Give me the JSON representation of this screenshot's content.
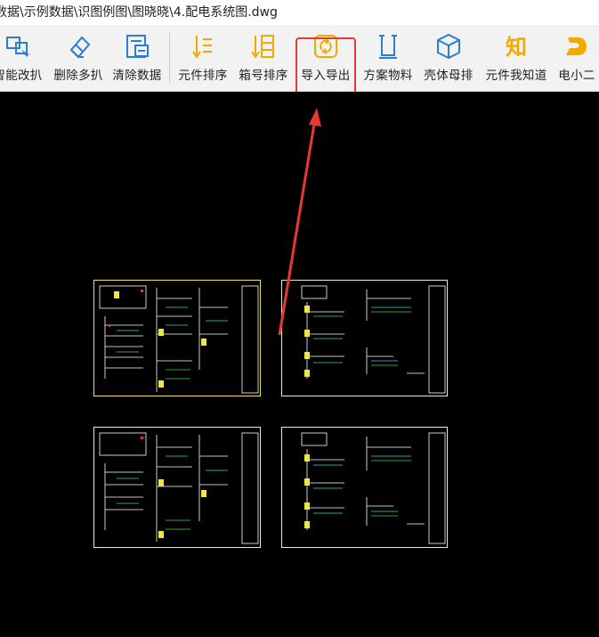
{
  "window": {
    "title": "数据\\示例数据\\识图例图\\图晓晓\\4.配电系统图.dwg"
  },
  "toolbar": {
    "buttons": [
      {
        "label": "智能改扒",
        "icon": "smart-edit-icon",
        "color": "#2b7fd3"
      },
      {
        "label": "删除多扒",
        "icon": "eraser-icon",
        "color": "#2b7fd3"
      },
      {
        "label": "清除数据",
        "icon": "clear-data-icon",
        "color": "#2b7fd3"
      },
      {
        "label": "元件排序",
        "icon": "sort-components-icon",
        "color": "#f2a900"
      },
      {
        "label": "箱号排序",
        "icon": "sort-box-icon",
        "color": "#f2a900"
      },
      {
        "label": "导入导出",
        "icon": "import-export-icon",
        "color": "#f2a900"
      },
      {
        "label": "方案物料",
        "icon": "materials-icon",
        "color": "#2b7fd3"
      },
      {
        "label": "壳体母排",
        "icon": "cube-icon",
        "color": "#2b7fd3"
      },
      {
        "label": "元件我知道",
        "icon": "knowledge-icon",
        "color": "#f2a900"
      },
      {
        "label": "电小二",
        "icon": "assistant-logo-icon",
        "color": "#f2a900"
      }
    ],
    "highlighted_button": "导入导出"
  },
  "annotation": {
    "highlight_color": "#e53935",
    "arrow_color": "#e53935"
  },
  "canvas": {
    "background": "#000000",
    "sheets": [
      {
        "name": "sheet-top-left",
        "border": "#f1e34a"
      },
      {
        "name": "sheet-top-right",
        "border": "#e8e8e8"
      },
      {
        "name": "sheet-bottom-left",
        "border": "#e8e8e8"
      },
      {
        "name": "sheet-bottom-right",
        "border": "#e8e8e8"
      }
    ]
  }
}
